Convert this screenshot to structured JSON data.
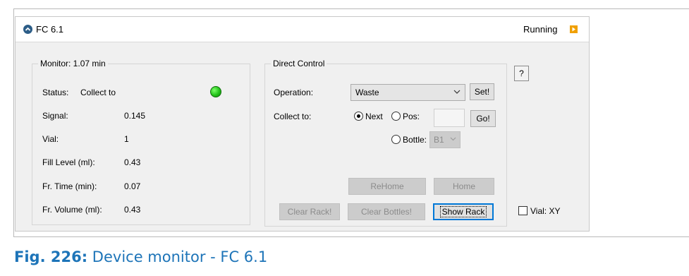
{
  "window": {
    "title": "FC 6.1",
    "status": "Running"
  },
  "monitor": {
    "legend": "Monitor: 1.07 min",
    "status_label": "Status:",
    "status_value": "Collect to",
    "rows": [
      {
        "label": "Signal:",
        "value": "0.145"
      },
      {
        "label": "Vial:",
        "value": "1"
      },
      {
        "label": "Fill Level (ml):",
        "value": "0.43"
      },
      {
        "label": "Fr. Time (min):",
        "value": "0.07"
      },
      {
        "label": "Fr. Volume (ml):",
        "value": "0.43"
      }
    ]
  },
  "direct_control": {
    "legend": "Direct Control",
    "operation_label": "Operation:",
    "operation_value": "Waste",
    "set_button": "Set!",
    "collect_label": "Collect to:",
    "next_label": "Next",
    "pos_label": "Pos:",
    "pos_value": "",
    "go_button": "Go!",
    "bottle_label": "Bottle:",
    "bottle_value": "B1",
    "rehome_button": "ReHome",
    "home_button": "Home",
    "clear_rack_button": "Clear Rack!",
    "clear_bottles_button": "Clear Bottles!",
    "show_rack_button": "Show Rack"
  },
  "help_button": "?",
  "vial_checkbox_label": "Vial: XY",
  "caption": {
    "fig": "Fig. 226:",
    "text": "Device monitor - FC 6.1"
  },
  "colors": {
    "caption": "#1d74b8",
    "led": "#23c21a",
    "run_icon": "#f0a000",
    "title_icon": "#2c5d87"
  }
}
